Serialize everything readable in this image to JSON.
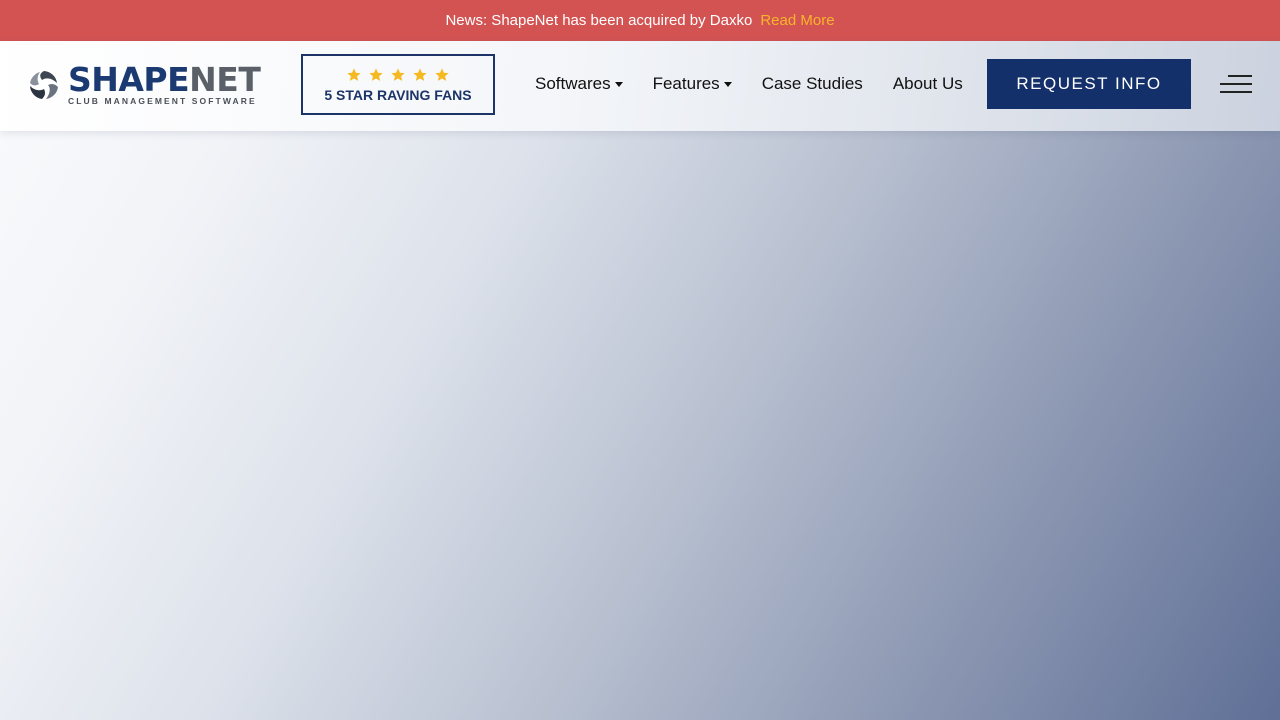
{
  "news_bar": {
    "text": "News: ShapeNet has been acquired by Daxko",
    "link_label": "Read More",
    "background_color": "#d35353",
    "link_color": "#f7b52b"
  },
  "header": {
    "logo": {
      "word_part1": "SHAPE",
      "word_part2": "NET",
      "tagline": "CLUB MANAGEMENT SOFTWARE"
    },
    "rating_badge": {
      "stars": 5,
      "label": "5 STAR RAVING FANS",
      "star_color": "#f5b922"
    },
    "nav": {
      "items": [
        {
          "label": "Softwares",
          "has_dropdown": true
        },
        {
          "label": "Features",
          "has_dropdown": true
        },
        {
          "label": "Case Studies",
          "has_dropdown": false
        },
        {
          "label": "About Us",
          "has_dropdown": false
        }
      ]
    },
    "cta": {
      "label": "REQUEST INFO",
      "color": "#13306a"
    },
    "menu_icon": "hamburger-icon"
  }
}
